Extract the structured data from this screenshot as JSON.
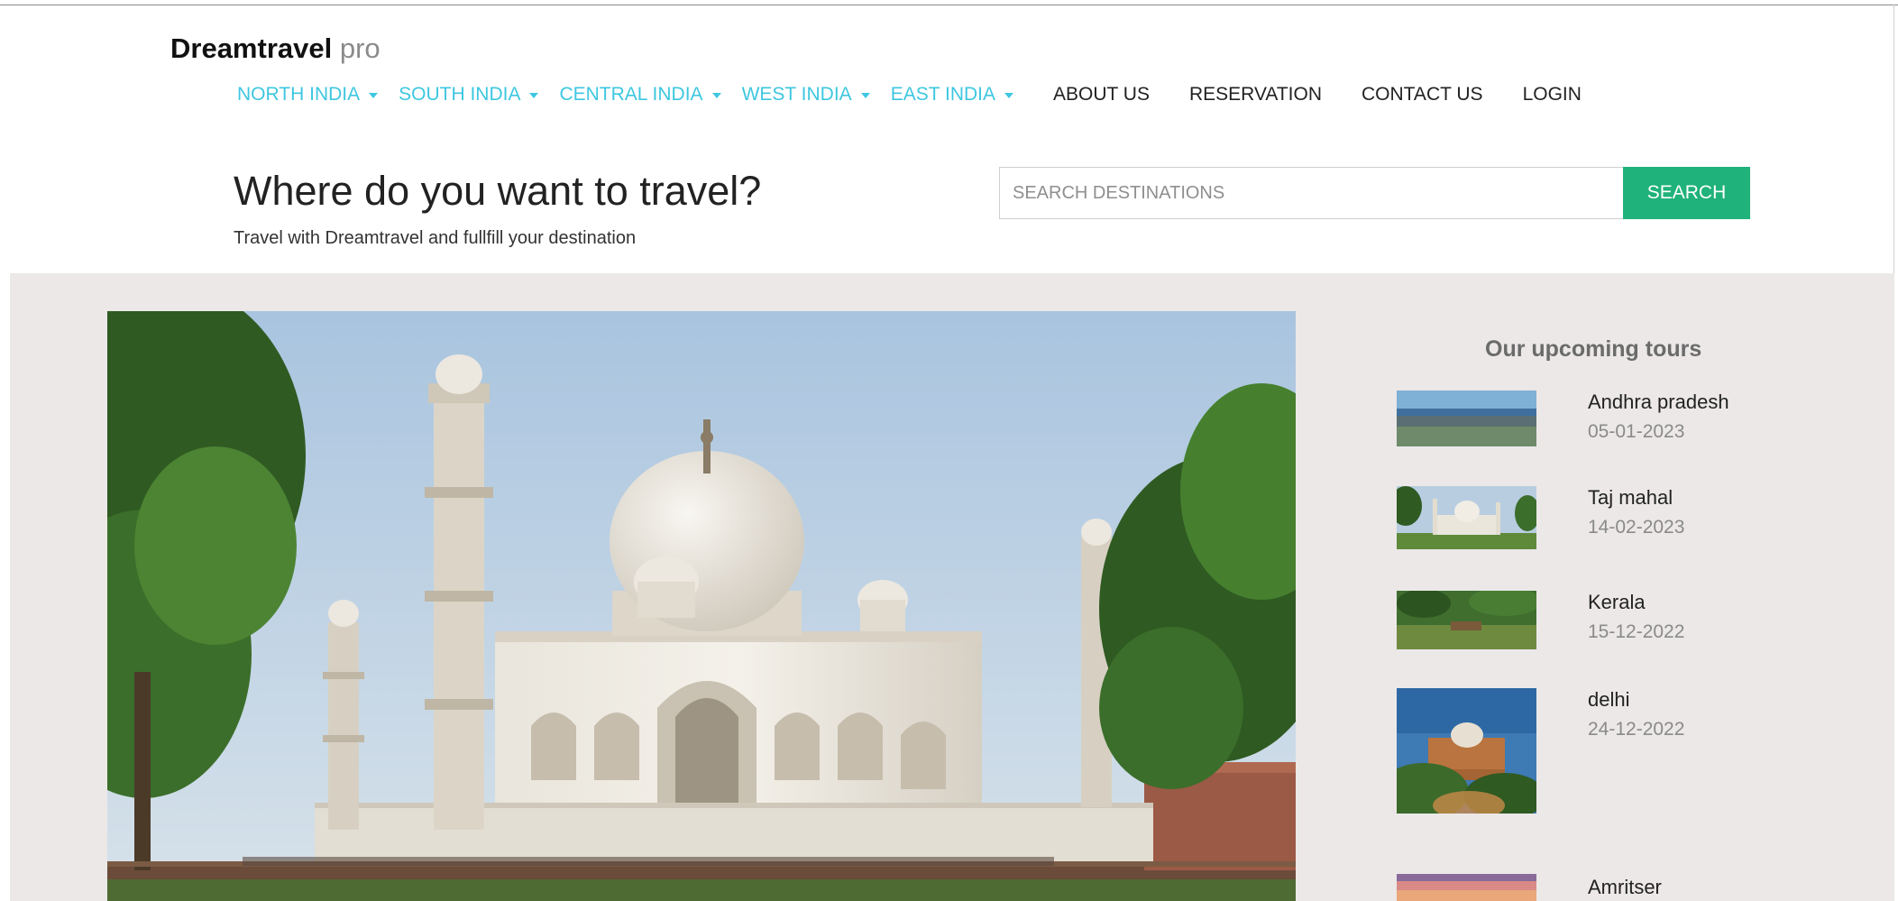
{
  "brand": {
    "name": "Dreamtravel",
    "suffix": "pro"
  },
  "nav": {
    "regions": [
      "NORTH INDIA",
      "SOUTH INDIA",
      "CENTRAL INDIA",
      "WEST INDIA",
      "EAST INDIA"
    ],
    "links": [
      "ABOUT US",
      "RESERVATION",
      "CONTACT US",
      "LOGIN"
    ]
  },
  "hero": {
    "title": "Where do you want to travel?",
    "subtitle": "Travel with Dreamtravel and fullfill your destination"
  },
  "search": {
    "placeholder": "SEARCH DESTINATIONS",
    "button": "SEARCH"
  },
  "tours": {
    "title": "Our upcoming tours",
    "items": [
      {
        "name": "Andhra pradesh",
        "date": "05-01-2023",
        "thumb": "coastal-city-photo"
      },
      {
        "name": "Taj mahal",
        "date": "14-02-2023",
        "thumb": "taj-mahal-photo"
      },
      {
        "name": "Kerala",
        "date": "15-12-2022",
        "thumb": "backwaters-photo"
      },
      {
        "name": "delhi",
        "date": "24-12-2022",
        "thumb": "tomb-monument-photo"
      },
      {
        "name": "Amritser",
        "date": "",
        "thumb": "sunset-photo"
      }
    ]
  },
  "colors": {
    "accent": "#3ec7e0",
    "search_button": "#1fb27a",
    "content_bg": "#ebe8e7"
  },
  "hero_image": "taj-mahal-hero-photo"
}
